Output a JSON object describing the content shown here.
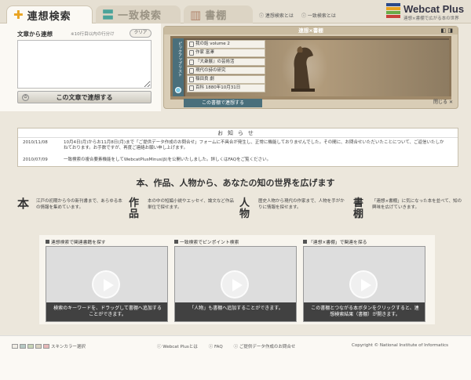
{
  "tabs": {
    "assoc": {
      "icon": "plus-icon",
      "label": "連想検索"
    },
    "match": {
      "icon": "equals-icon",
      "label": "一致検索"
    },
    "shelf": {
      "icon": "bookshelf-icon",
      "label": "書棚"
    }
  },
  "header_links": [
    "連想検索とは",
    "一致検索とは"
  ],
  "logo": {
    "title": "Webcat Plus",
    "subtitle": "連想×書棚で広がる本の世界",
    "bar_colors": [
      "#2a4a8a",
      "#e8a320",
      "#6aaa48",
      "#c8413a"
    ]
  },
  "left": {
    "title": "文章から連想",
    "hint": "※10行目以内の行分け",
    "clear": "クリア",
    "textarea_value": "",
    "submit": "この文章で連想する"
  },
  "shelf": {
    "title": "連想×書棚",
    "side_label": "ピックアップリスト",
    "books": [
      "我の話 volume 2",
      "作家 富澤",
      "『大衆展』の芸術活",
      "現代の詩の研究",
      "稲田良 劇",
      "百科 1880年10月31日"
    ],
    "send_label": "この書棚で連想する",
    "close_label": "閉じる"
  },
  "notice": {
    "title": "お知らせ",
    "items": [
      {
        "date": "2010/11/08",
        "text": "10月4日(月)からお11月8日(月)まで「ご提供データ作成のお問合せ」フォームに不具合が発生し、正常に機能しておりませんでした。その間に、お問合せいただいたことについて、ご返信いたしかねております。お手数ですが、再度ご連絡お願い申し上げます。"
      },
      {
        "date": "2010/07/09",
        "text": "一致検索の複合要素機能をしてWebcatPlusMinus(β)を公開いたしました。詳しくはFAQをご覧ください。"
      }
    ]
  },
  "tagline": "本、作品、人物から、あなたの知の世界を広げます",
  "features": [
    {
      "key": "本",
      "text": "江戸の初期から今の新刊書まで、あらゆる本の情報を集めています。"
    },
    {
      "key": "作品",
      "text": "本の中の短編小説やエッセイ、論文など作品単位で探せます。"
    },
    {
      "key": "人物",
      "text": "歴史人物から現代の作家まで、人物を手がかりに情報を探せます。"
    },
    {
      "key": "書棚",
      "text": "「連想×書棚」に気になった本を並べて、知の興味を広げていきます。"
    }
  ],
  "videos": [
    {
      "title": "連想検索で関連書籍を探す",
      "caption": "検索のキーワードを、ドラッグして書棚へ追加することができます。",
      "play_icon": "play-icon"
    },
    {
      "title": "一致検索でピンポイント検索",
      "caption": "「人物」も書棚へ追加することができます。",
      "play_icon": "play-icon"
    },
    {
      "title": "「連想×書棚」で関連を探る",
      "caption": "この書棚とつながる本ボタンをクリックすると、連想検索結果（書棚）が開きます。",
      "play_icon": "play-icon"
    }
  ],
  "footer": {
    "swatches": [
      "#f0ede5",
      "#b7c9c4",
      "#c8d6b7",
      "#d9d2c0",
      "#e6b8b8"
    ],
    "swatch_label": "スキンカラー選択",
    "links": [
      "Webcat Plusとは",
      "FAQ",
      "ご提供データ作成のお問合せ"
    ],
    "copyright": "Copyright © National Institute of Informatics"
  }
}
